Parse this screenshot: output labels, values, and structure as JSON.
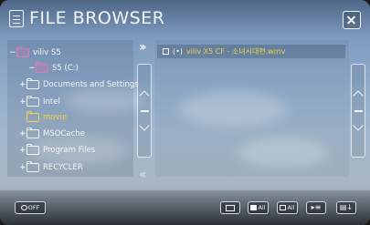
{
  "window": {
    "title": "FILE BROWSER",
    "close_icon": "close-icon"
  },
  "tree": {
    "items": [
      {
        "label": "viliv S5",
        "icon": "device-icon",
        "expander": "−",
        "active": false
      },
      {
        "label": "S5 (C:)",
        "icon": "drive-icon",
        "expander": "−",
        "active": false
      },
      {
        "label": "Documents and Settings",
        "icon": "folder-icon",
        "expander": "+",
        "active": false
      },
      {
        "label": "Intel",
        "icon": "folder-icon",
        "expander": "+",
        "active": false
      },
      {
        "label": "movie",
        "icon": "folder-open-icon",
        "expander": "",
        "active": true
      },
      {
        "label": "MSOCache",
        "icon": "folder-icon",
        "expander": "+",
        "active": false
      },
      {
        "label": "Program Files",
        "icon": "folder-icon",
        "expander": "+",
        "active": false
      },
      {
        "label": "RECYCLER",
        "icon": "folder-icon",
        "expander": "+",
        "active": false
      }
    ]
  },
  "files": {
    "items": [
      {
        "label": "viliv X5 CF - 소녀시대편.wmv",
        "mark": "(•)"
      }
    ]
  },
  "toolbar": {
    "power_label": "OFF",
    "select_all_label": "All",
    "deselect_all_label": "All"
  },
  "colors": {
    "accent": "#f2d24a",
    "text": "#f4f6f8",
    "disk": "#e078b8"
  }
}
